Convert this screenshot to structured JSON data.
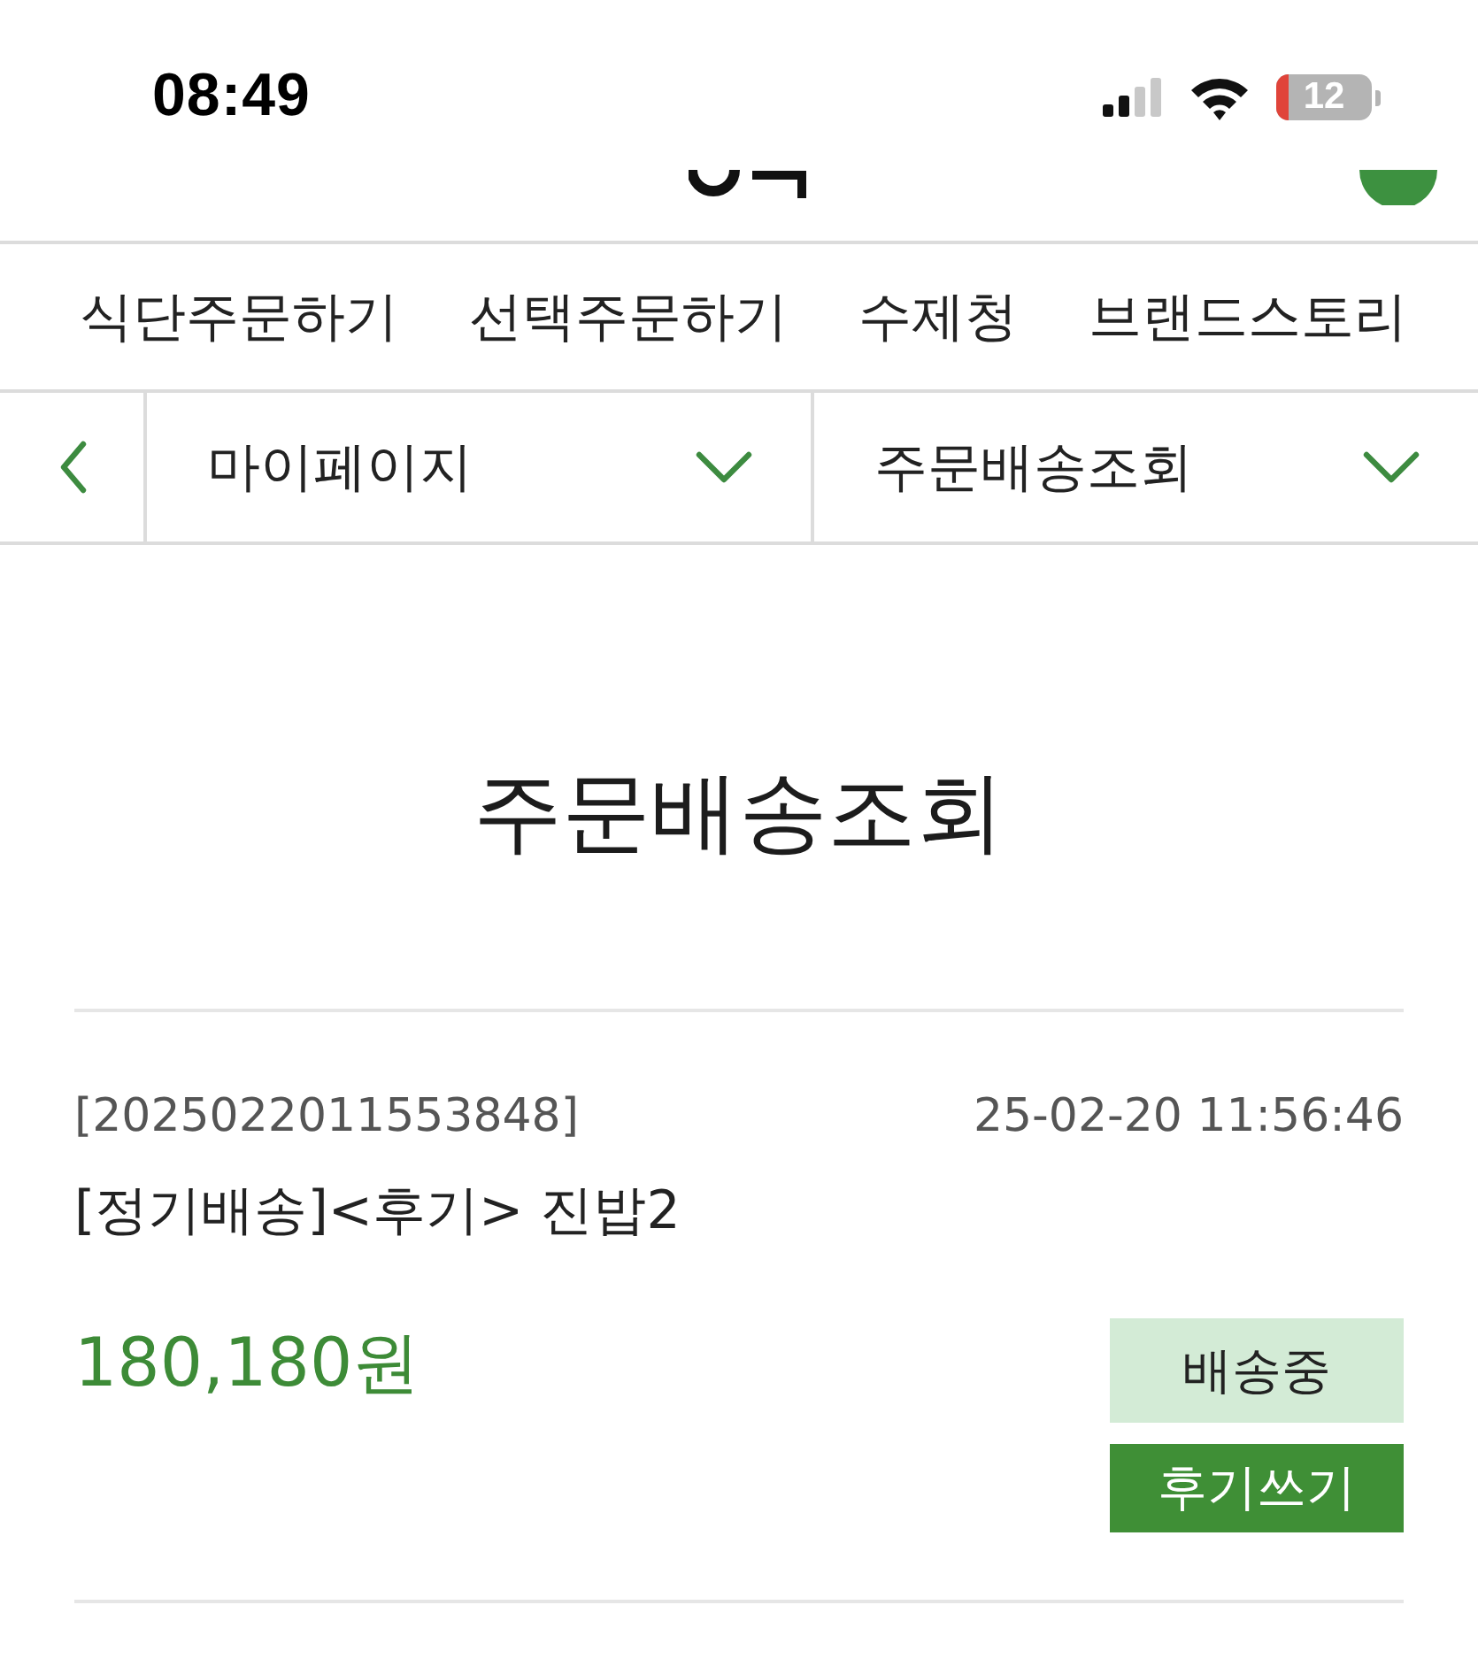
{
  "status_bar": {
    "time": "08:49",
    "battery": "12"
  },
  "nav": {
    "items": [
      {
        "label": "식단주문하기"
      },
      {
        "label": "선택주문하기"
      },
      {
        "label": "수제청"
      },
      {
        "label": "브랜드스토리"
      }
    ]
  },
  "breadcrumb": {
    "selects": [
      {
        "value": "마이페이지"
      },
      {
        "value": "주문배송조회"
      }
    ]
  },
  "page_title": "주문배송조회",
  "orders": [
    {
      "number": "[2025022011553848]",
      "date": "25-02-20 11:56:46",
      "product": "[정기배송]<후기> 진밥2",
      "price": "180,180원",
      "status": "배송중",
      "action": "후기쓰기"
    }
  ]
}
